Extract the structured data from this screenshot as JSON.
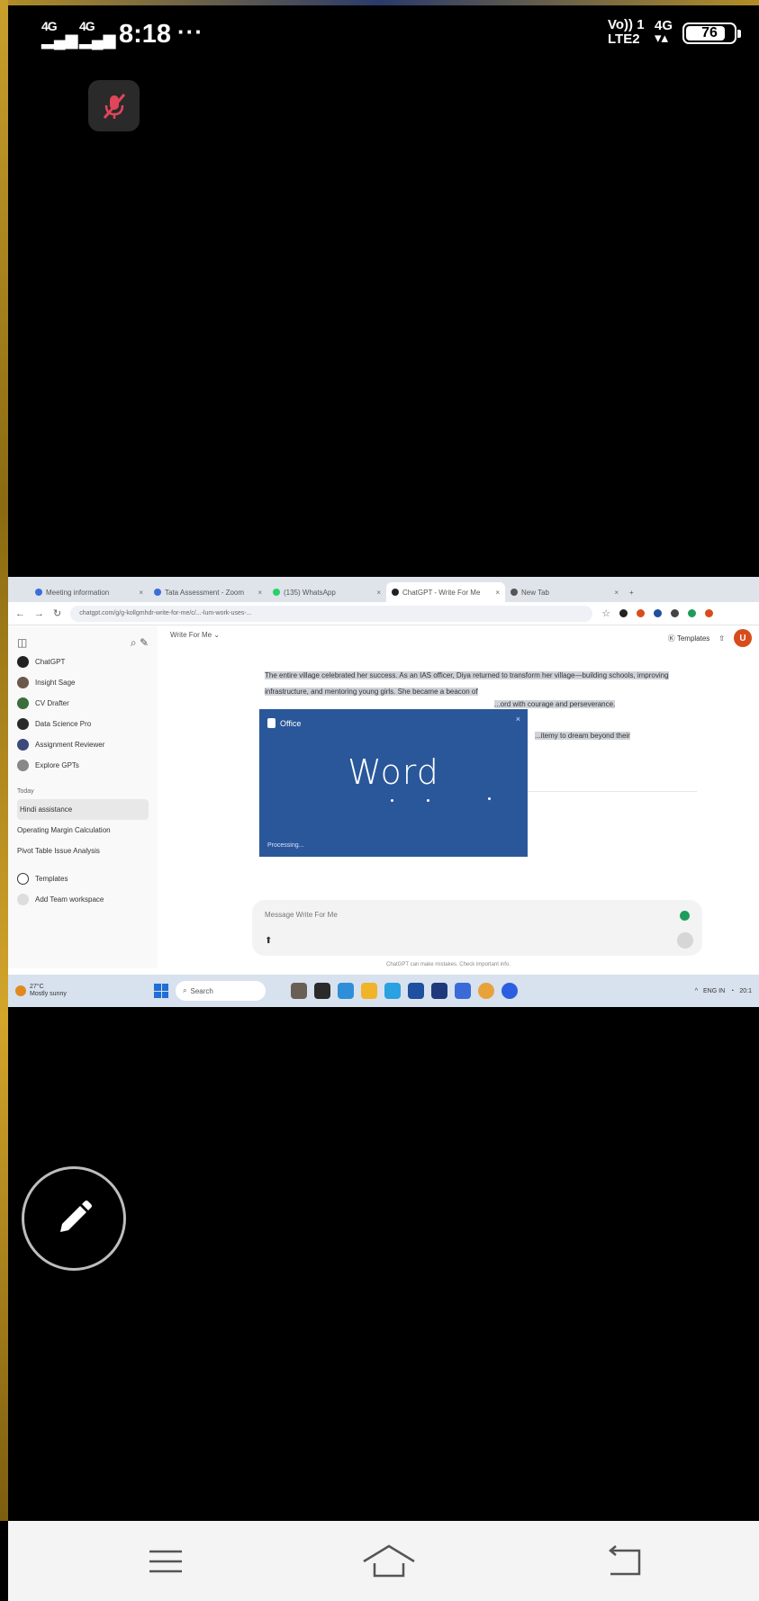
{
  "status_bar": {
    "sim1": "4G",
    "sim2": "4G",
    "time": "8:18",
    "more": "···",
    "network": "Vo)) 1",
    "network_sub": "LTE2",
    "network2": "4G",
    "battery": "76"
  },
  "shared_screen": {
    "tabs": [
      {
        "label": "Meeting information",
        "color": "#3b6fd8"
      },
      {
        "label": "Tata Assessment - Zoom",
        "color": "#3b6fd8"
      },
      {
        "label": "(135) WhatsApp",
        "color": "#25d366"
      },
      {
        "label": "ChatGPT - Write For Me",
        "color": "#222222"
      },
      {
        "label": "New Tab",
        "color": "#555555"
      }
    ],
    "url": "chatgpt.com/g/g-kollgmhdr-write-for-me/c/...-lum-work-uses-...",
    "sidebar": {
      "gpts": [
        {
          "label": "ChatGPT",
          "color": "#222222"
        },
        {
          "label": "Insight Sage",
          "color": "#6b5a4a"
        },
        {
          "label": "CV Drafter",
          "color": "#3c6e3c"
        },
        {
          "label": "Data Science Pro",
          "color": "#2a2a2a"
        },
        {
          "label": "Assignment Reviewer",
          "color": "#3c4a7a"
        },
        {
          "label": "Explore GPTs",
          "color": "#888888"
        }
      ],
      "section": "Today",
      "chats": [
        "Hindi assistance",
        "Operating Margin Calculation",
        "Pivot Table Issue Analysis"
      ],
      "templates": "Templates",
      "add_team": "Add Team workspace"
    },
    "header": {
      "title": "Write For Me ⌄",
      "templates": "Templates",
      "avatar": "U"
    },
    "selected_text": "The entire village celebrated her success. As an IAS officer, Diya returned to transform her village—building schools, improving infrastructure, and mentoring young girls. She became a beacon of",
    "selected_text_2": "...ord with courage and perseverance.",
    "selected_text_3": "...itemy to dream beyond their",
    "message_placeholder": "Message Write For Me",
    "footnote": "ChatGPT can make mistakes. Check important info.",
    "word_splash": {
      "brand": "Office",
      "title": "Word",
      "status": "Processing...",
      "color": "#2a579a"
    },
    "taskbar": {
      "weather": "27°C",
      "weather_sub": "Mostly sunny",
      "search": "Search",
      "tray_lang": "ENG IN",
      "tray_time": "20:1"
    }
  },
  "navbar": {
    "menu_icon": "menu-icon",
    "home_icon": "home-icon",
    "back_icon": "back-icon"
  },
  "floating": {
    "icon": "pencil-icon"
  }
}
